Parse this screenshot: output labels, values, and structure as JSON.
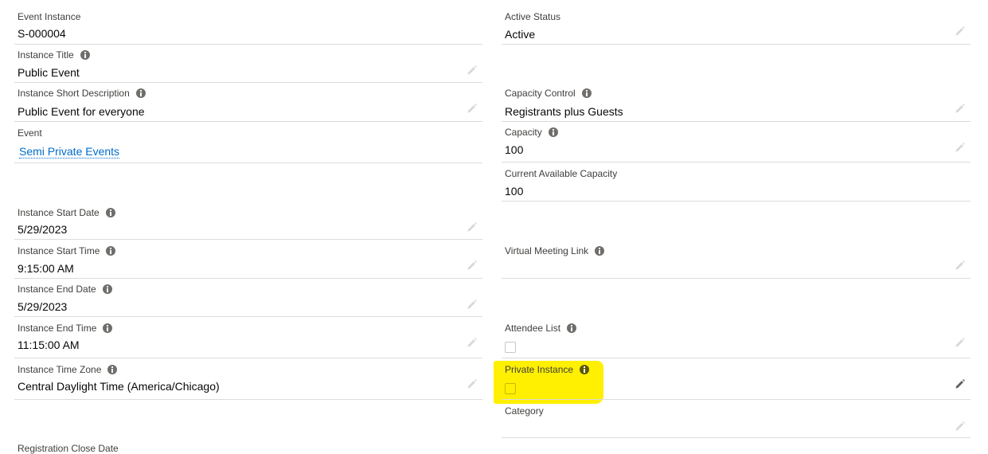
{
  "left_column": [
    {
      "label": "Event Instance",
      "value": "S-000004",
      "info": false,
      "editable": false
    },
    {
      "label": "Instance Title",
      "value": "Public Event",
      "info": true,
      "editable": true
    },
    {
      "label": "Instance Short Description",
      "value": "Public Event for everyone",
      "info": true,
      "editable": true
    },
    {
      "label": "Event",
      "value": "Semi Private Events",
      "info": false,
      "editable": false,
      "link": true
    },
    {
      "label": "Instance Start Date",
      "value": "5/29/2023",
      "info": true,
      "editable": true
    },
    {
      "label": "Instance Start Time",
      "value": "9:15:00 AM",
      "info": true,
      "editable": true
    },
    {
      "label": "Instance End Date",
      "value": "5/29/2023",
      "info": true,
      "editable": true
    },
    {
      "label": "Instance End Time",
      "value": "11:15:00 AM",
      "info": true,
      "editable": true
    },
    {
      "label": "Instance Time Zone",
      "value": "Central Daylight Time (America/Chicago)",
      "info": true,
      "editable": true
    },
    {
      "label": "Registration Close Date",
      "value": "",
      "info": false,
      "editable": false
    }
  ],
  "right_column": [
    {
      "label": "Active Status",
      "value": "Active",
      "info": false,
      "editable": true
    },
    {
      "label": "Capacity Control",
      "value": "Registrants plus Guests",
      "info": true,
      "editable": true
    },
    {
      "label": "Capacity",
      "value": "100",
      "info": true,
      "editable": true
    },
    {
      "label": "Current Available Capacity",
      "value": "100",
      "info": false,
      "editable": false
    },
    {
      "label": "Virtual Meeting Link",
      "value": "",
      "info": true,
      "editable": true
    },
    {
      "label": "Attendee List",
      "type": "checkbox",
      "checked": false,
      "info": true,
      "editable": true
    },
    {
      "label": "Private Instance",
      "type": "checkbox",
      "checked": false,
      "info": true,
      "editable": true,
      "highlighted": true
    },
    {
      "label": "Category",
      "value": "",
      "info": false,
      "editable": true
    }
  ],
  "colors": {
    "link": "#006dcc",
    "highlight": "#ffef00",
    "divider": "#dddbda"
  }
}
